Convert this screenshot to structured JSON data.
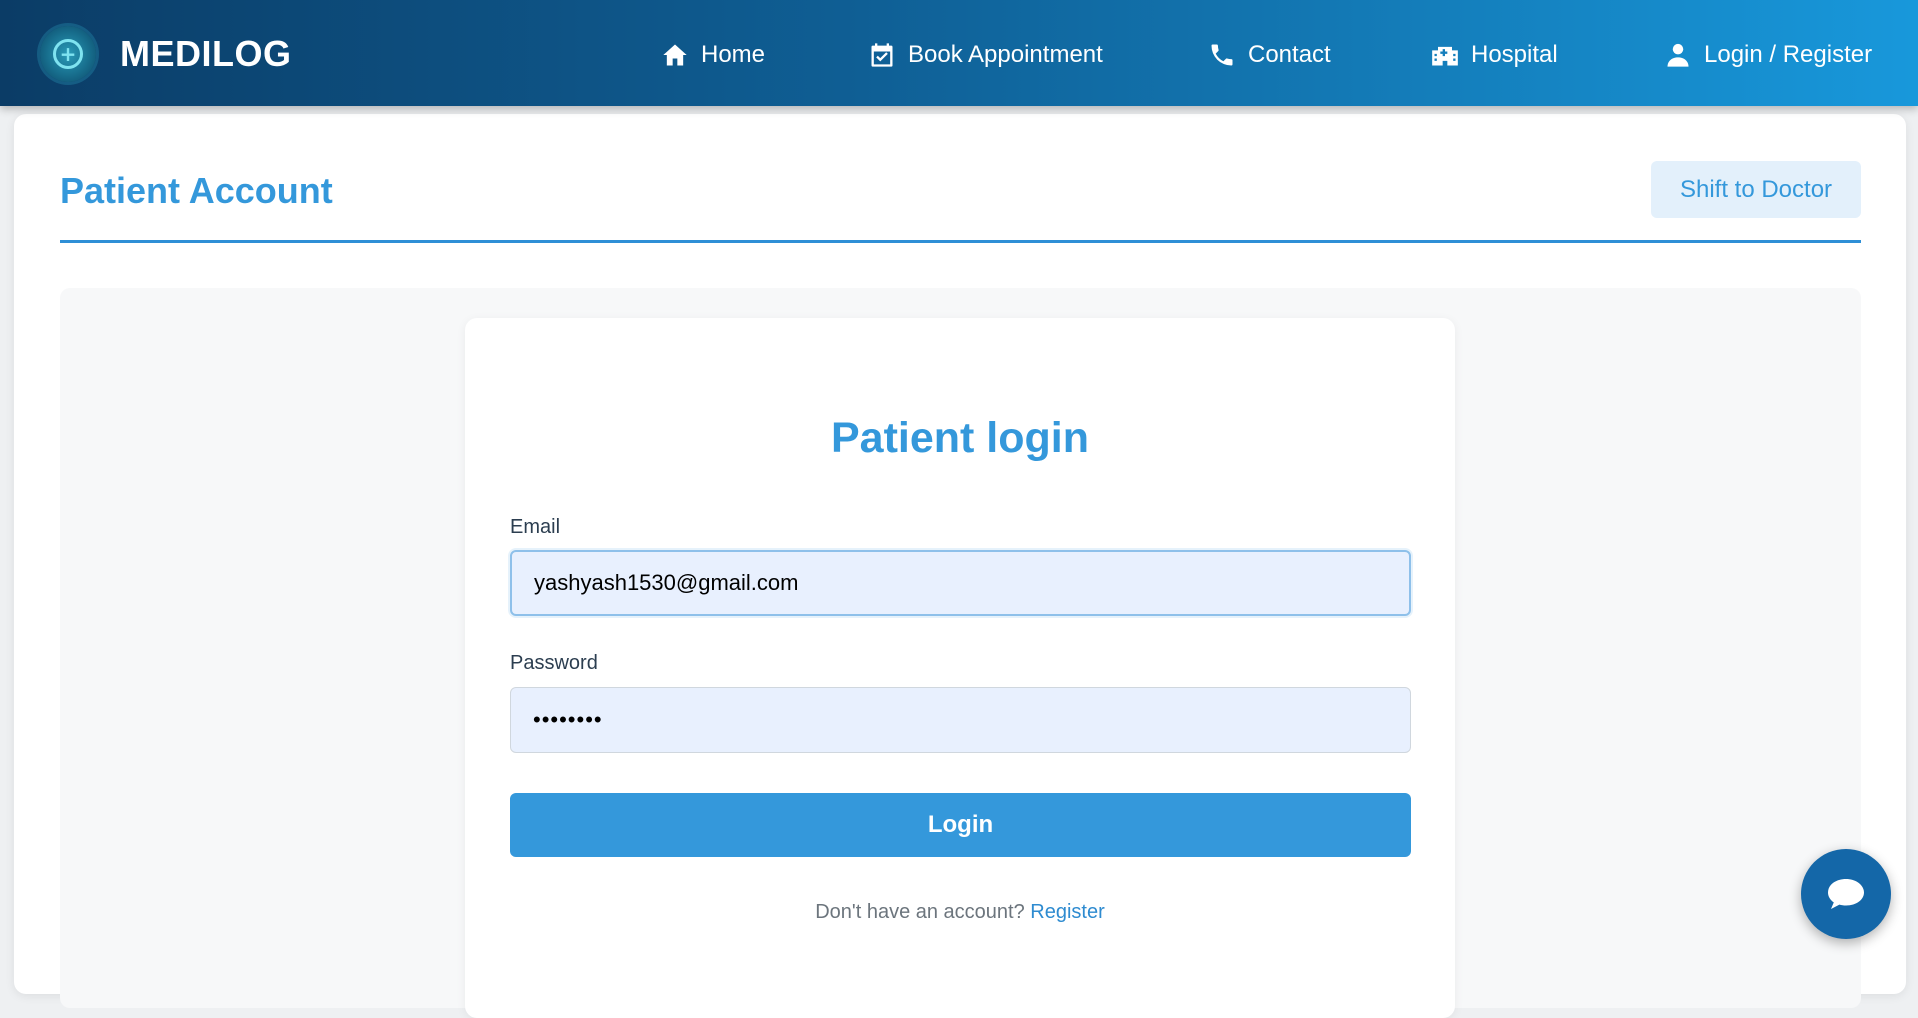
{
  "brand": {
    "name": "MEDILOG",
    "logo_icon": "medical-cross-icon"
  },
  "nav": [
    {
      "label": "Home",
      "icon": "home-icon"
    },
    {
      "label": "Book Appointment",
      "icon": "calendar-check-icon"
    },
    {
      "label": "Contact",
      "icon": "phone-icon"
    },
    {
      "label": "Hospital",
      "icon": "hospital-icon"
    },
    {
      "label": "Login / Register",
      "icon": "user-icon"
    }
  ],
  "page": {
    "title": "Patient Account",
    "shift_button": "Shift to Doctor"
  },
  "login": {
    "title": "Patient login",
    "email_label": "Email",
    "email_value": "yashyash1530@gmail.com",
    "password_label": "Password",
    "password_value": "password",
    "submit_label": "Login",
    "register_prompt": "Don't have an account?",
    "register_link": "Register"
  },
  "chat": {
    "icon": "chat-bubble-icon"
  },
  "colors": {
    "accent": "#3498db",
    "nav_gradient_start": "#0b3c66",
    "nav_gradient_end": "#1898db",
    "input_bg": "#e8f0fe",
    "chat_bg": "#1467a8"
  }
}
